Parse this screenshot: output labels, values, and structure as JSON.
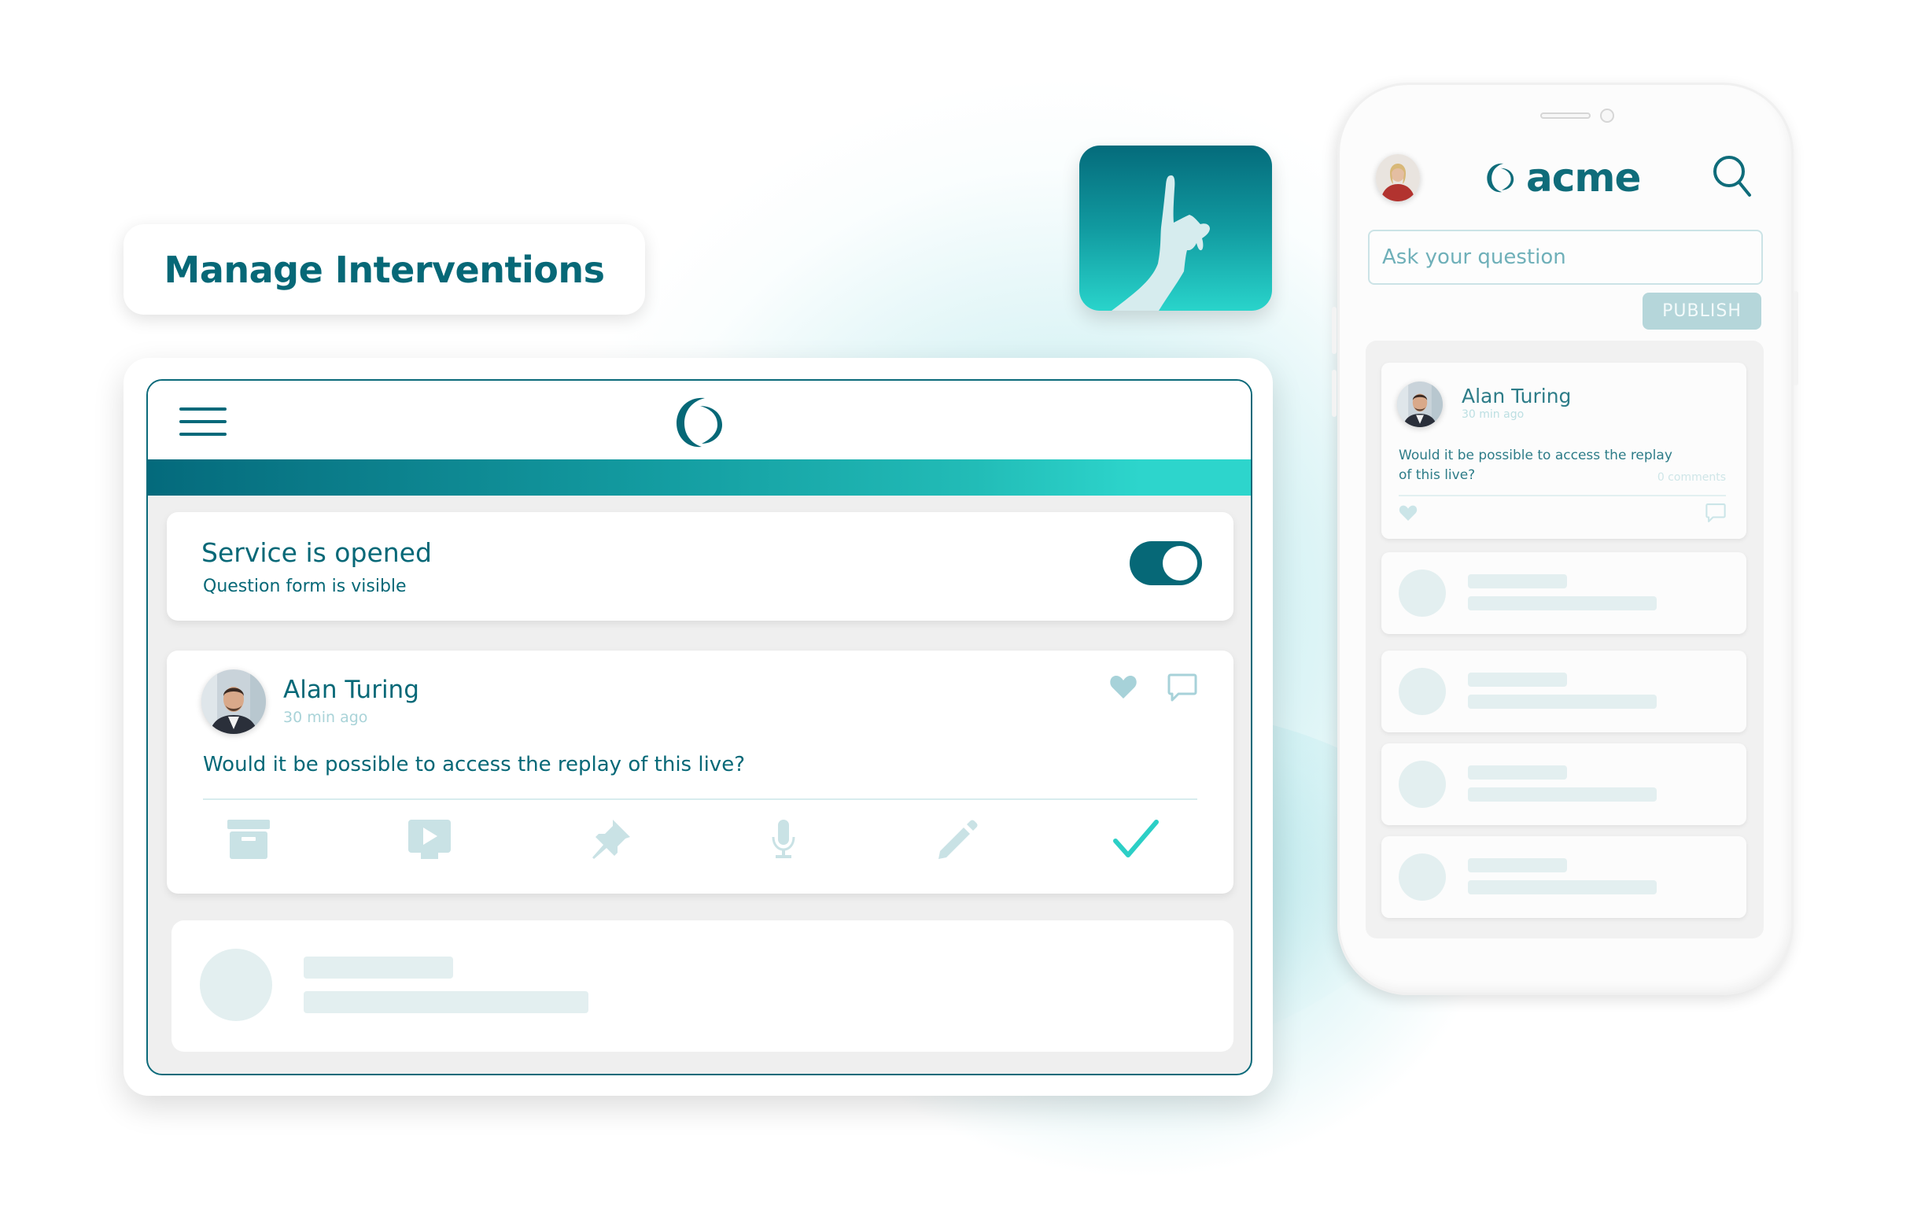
{
  "title_card": {
    "title": "Manage Interventions"
  },
  "tablet": {
    "service": {
      "title": "Service is opened",
      "subtitle": "Question form is visible",
      "toggle_on": true
    },
    "question": {
      "author": "Alan Turing",
      "time": "30 min ago",
      "text": "Would it be possible to access the replay of this live?",
      "actions": [
        {
          "name": "archive",
          "icon": "archive-icon"
        },
        {
          "name": "play-video",
          "icon": "video-play-icon"
        },
        {
          "name": "pin",
          "icon": "pin-icon"
        },
        {
          "name": "microphone",
          "icon": "microphone-icon"
        },
        {
          "name": "edit",
          "icon": "pencil-icon"
        },
        {
          "name": "validate",
          "icon": "check-icon"
        }
      ]
    }
  },
  "phone": {
    "brand": "acme",
    "input": {
      "placeholder": "Ask your question",
      "value": ""
    },
    "publish_label": "PUBLISH",
    "question": {
      "author": "Alan Turing",
      "time": "30 min ago",
      "text": "Would it be possible to access the replay of this live?",
      "comments": "0 comments"
    },
    "placeholder_cards": 4
  },
  "colors": {
    "primary": "#066877",
    "accent": "#2dd5cc",
    "muted": "#b5d6da",
    "background": "#efefef"
  }
}
